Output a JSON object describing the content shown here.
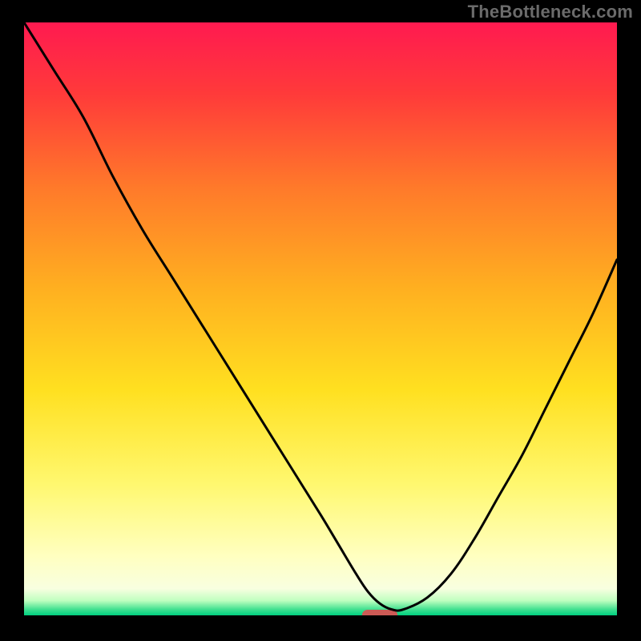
{
  "watermark": "TheBottleneck.com",
  "chart_data": {
    "type": "line",
    "title": "",
    "xlabel": "",
    "ylabel": "",
    "xlim": [
      0,
      100
    ],
    "ylim": [
      0,
      100
    ],
    "grid": false,
    "legend": false,
    "background_gradient": [
      {
        "stop": 0.0,
        "color": "#ff1a50"
      },
      {
        "stop": 0.12,
        "color": "#ff3a3a"
      },
      {
        "stop": 0.28,
        "color": "#ff7a2a"
      },
      {
        "stop": 0.45,
        "color": "#ffb020"
      },
      {
        "stop": 0.62,
        "color": "#ffe020"
      },
      {
        "stop": 0.78,
        "color": "#fff870"
      },
      {
        "stop": 0.9,
        "color": "#ffffc0"
      },
      {
        "stop": 0.955,
        "color": "#f8ffe0"
      },
      {
        "stop": 0.975,
        "color": "#c0ffc0"
      },
      {
        "stop": 0.99,
        "color": "#40e090"
      },
      {
        "stop": 1.0,
        "color": "#00d080"
      }
    ],
    "series": [
      {
        "name": "bottleneck-curve",
        "color": "#000000",
        "x": [
          0,
          5,
          10,
          15,
          20,
          25,
          30,
          35,
          40,
          45,
          50,
          53,
          56,
          58,
          60,
          62,
          64,
          68,
          72,
          76,
          80,
          84,
          88,
          92,
          96,
          100
        ],
        "y": [
          100,
          92,
          84,
          74,
          65,
          57,
          49,
          41,
          33,
          25,
          17,
          12,
          7,
          4,
          2,
          1,
          1,
          3,
          7,
          13,
          20,
          27,
          35,
          43,
          51,
          60
        ]
      }
    ],
    "markers": [
      {
        "name": "optimal-zone",
        "shape": "pill",
        "color": "#cc5a55",
        "x_center": 60,
        "y": 0,
        "width_x": 6
      }
    ]
  }
}
